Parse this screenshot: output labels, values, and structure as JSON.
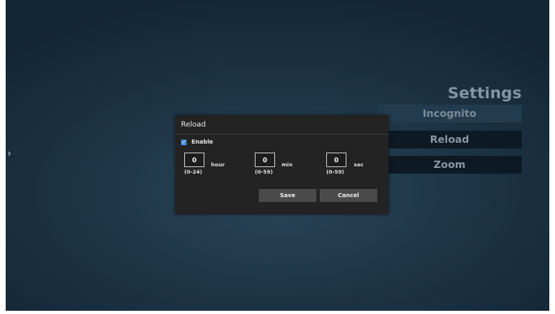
{
  "nav": {
    "left_arrow": "›",
    "right_arrow": "‹"
  },
  "settings": {
    "title": "Settings",
    "menu": [
      {
        "label": "Incognito"
      },
      {
        "label": "Reload"
      },
      {
        "label": "Zoom"
      }
    ]
  },
  "dialog": {
    "title": "Reload",
    "enable": {
      "label": "Enable",
      "checked": true,
      "check_glyph": "✓"
    },
    "fields": [
      {
        "value": "0",
        "unit": "hour",
        "range": "(0-24)"
      },
      {
        "value": "0",
        "unit": "min",
        "range": "(0-59)"
      },
      {
        "value": "0",
        "unit": "sec",
        "range": "(0-59)"
      }
    ],
    "save_label": "Save",
    "cancel_label": "Cancel"
  },
  "colors": {
    "accent_checkbox": "#4a8fe0",
    "dialog_bg": "#232323",
    "background": "#1c3344"
  }
}
